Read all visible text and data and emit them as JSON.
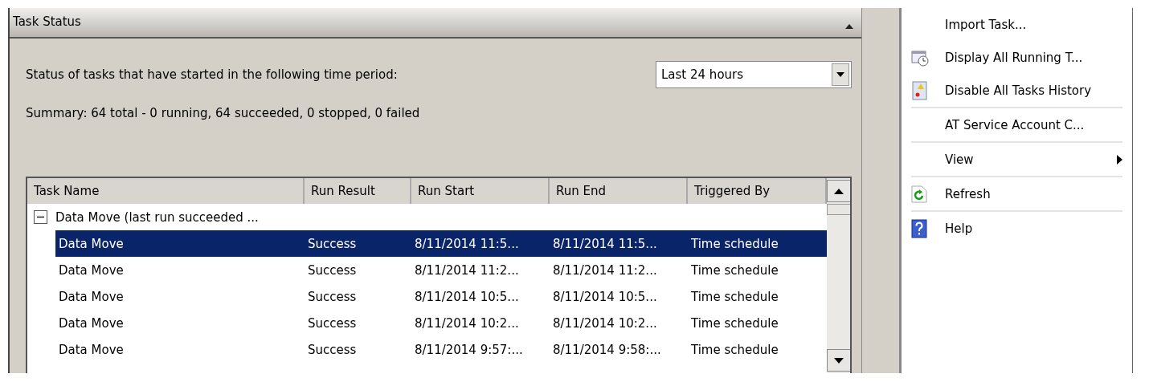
{
  "panel": {
    "title": "Task Status",
    "expanded": true,
    "prompt": "Status of tasks that have started in the following time period:",
    "period": {
      "value": "Last 24 hours"
    },
    "summary": "Summary: 64 total - 0 running, 64 succeeded, 0 stopped, 0 failed",
    "table": {
      "columns": [
        "Task Name",
        "Run Result",
        "Run Start",
        "Run End",
        "Triggered By"
      ],
      "group": {
        "label": "Data Move (last run succeeded ...",
        "expanded": true
      },
      "rows": [
        {
          "cells": [
            "Data Move",
            "Success",
            "8/11/2014 11:5...",
            "8/11/2014 11:5...",
            "Time schedule"
          ],
          "selected": true
        },
        {
          "cells": [
            "Data Move",
            "Success",
            "8/11/2014 11:2...",
            "8/11/2014 11:2...",
            "Time schedule"
          ],
          "selected": false
        },
        {
          "cells": [
            "Data Move",
            "Success",
            "8/11/2014 10:5...",
            "8/11/2014 10:5...",
            "Time schedule"
          ],
          "selected": false
        },
        {
          "cells": [
            "Data Move",
            "Success",
            "8/11/2014 10:2...",
            "8/11/2014 10:2...",
            "Time schedule"
          ],
          "selected": false
        },
        {
          "cells": [
            "Data Move",
            "Success",
            "8/11/2014 9:57:...",
            "8/11/2014 9:58:...",
            "Time schedule"
          ],
          "selected": false
        }
      ]
    }
  },
  "actions": [
    {
      "label": "Import Task...",
      "kind": "plain",
      "divider_below": false
    },
    {
      "label": "Display All Running T...",
      "kind": "clock",
      "divider_below": false
    },
    {
      "label": "Disable All Tasks History",
      "kind": "history",
      "divider_below": true
    },
    {
      "label": "AT Service Account C...",
      "kind": "plain",
      "divider_below": true
    },
    {
      "label": "View",
      "kind": "submenu",
      "divider_below": true
    },
    {
      "label": "Refresh",
      "kind": "refresh",
      "divider_below": true
    },
    {
      "label": "Help",
      "kind": "help",
      "divider_below": false
    }
  ]
}
